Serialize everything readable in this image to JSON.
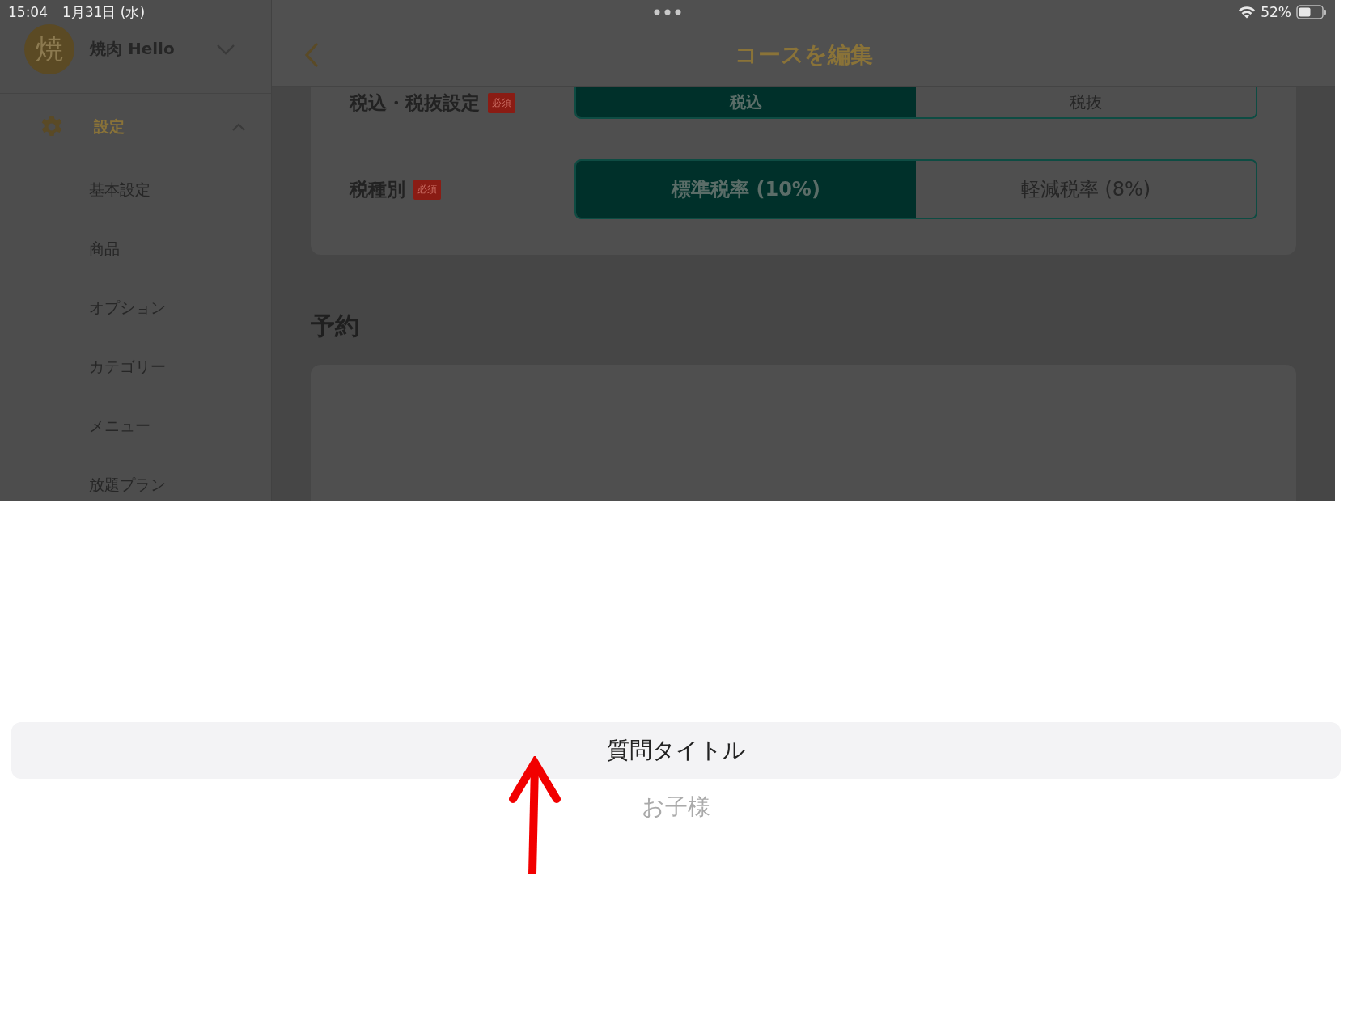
{
  "status_bar": {
    "time": "15:04",
    "date": "1月31日 (水)",
    "battery": "52%"
  },
  "sidebar": {
    "avatar": "焼",
    "shop_name": "焼肉 Hello",
    "section": {
      "label": "設定",
      "expanded": true
    },
    "items": [
      {
        "label": "基本設定"
      },
      {
        "label": "商品"
      },
      {
        "label": "オプション"
      },
      {
        "label": "カテゴリー"
      },
      {
        "label": "メニュー"
      },
      {
        "label": "放題プラン"
      }
    ]
  },
  "header": {
    "title": "コースを編集"
  },
  "tax_settings": [
    {
      "label": "税込・税抜設定",
      "badge": "必須",
      "options": [
        {
          "label": "税込",
          "selected": true
        },
        {
          "label": "税抜",
          "selected": false
        }
      ]
    },
    {
      "label": "税種別",
      "badge": "必須",
      "options": [
        {
          "label": "標準税率 (10%)",
          "selected": true
        },
        {
          "label": "軽減税率 (8%)",
          "selected": false
        }
      ]
    }
  ],
  "section_title": "予約",
  "picker": {
    "items": [
      {
        "label": "質問タイトル",
        "selected": true
      },
      {
        "label": "お子様",
        "selected": false
      }
    ]
  }
}
